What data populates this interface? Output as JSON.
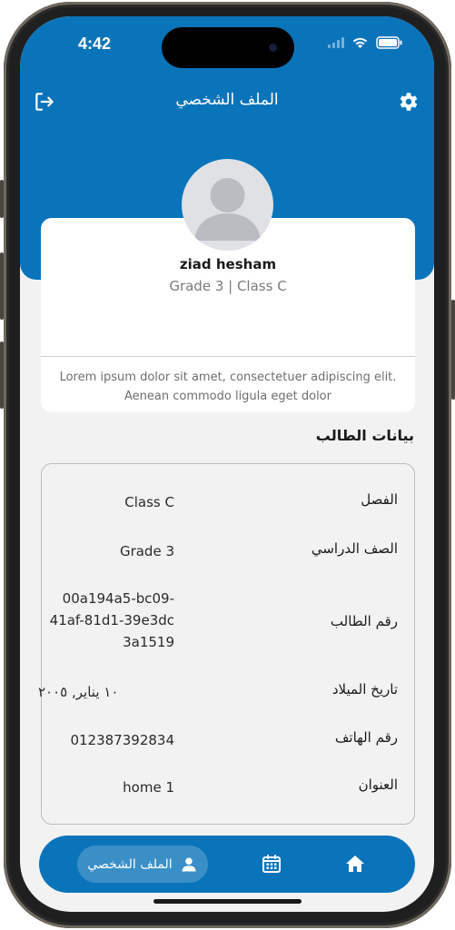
{
  "status_bar": {
    "time": "4:42"
  },
  "header": {
    "title": "الملف الشخصي"
  },
  "profile": {
    "name": "ziad hesham",
    "subtitle": "Grade 3 | Class C",
    "bio_line1": "Lorem ipsum dolor sit amet, consectetuer adipiscing elit.",
    "bio_line2": "Aenean commodo ligula eget dolor"
  },
  "section": {
    "title": "بيانات الطالب"
  },
  "info": {
    "class": {
      "label": "الفصل",
      "value": "Class C"
    },
    "grade": {
      "label": "الصف الدراسي",
      "value": "Grade 3"
    },
    "student_id": {
      "label": "رقم الطالب",
      "line1": "00a194a5-bc09-",
      "line2": "41af-81d1-39e3dc",
      "line3": "3a1519"
    },
    "birth_date": {
      "label": "تاريخ الميلاد",
      "value": "١٠ يناير, ٢٠٠٥"
    },
    "phone": {
      "label": "رقم الهاتف",
      "value": "012387392834"
    },
    "address": {
      "label": "العنوان",
      "value": "home 1"
    }
  },
  "nav": {
    "profile_label": "الملف الشخصي"
  },
  "icons": {
    "logout": "logout-icon",
    "settings": "gear-icon",
    "profile": "person-icon",
    "calendar": "calendar-icon",
    "home": "home-icon"
  },
  "colors": {
    "primary": "#0a74ba",
    "background": "#f2f2f2"
  }
}
